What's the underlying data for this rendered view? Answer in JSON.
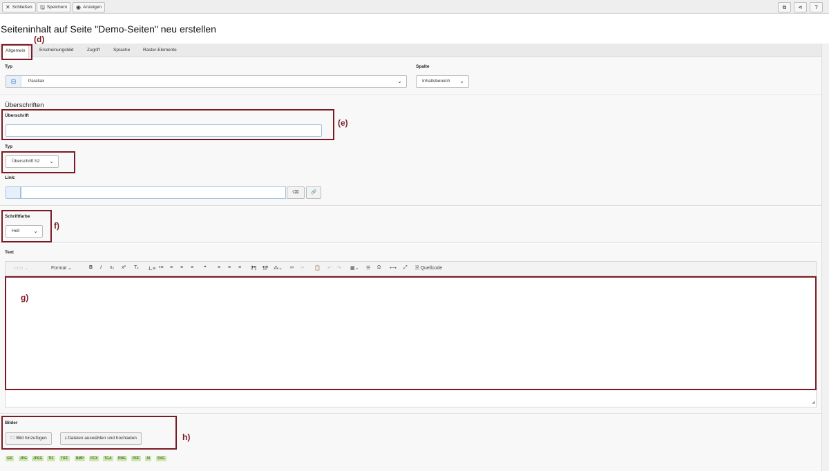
{
  "toolbar": {
    "close_label": "Schließen",
    "save_label": "Speichern",
    "view_label": "Anzeigen"
  },
  "page_title": "Seiteninhalt auf Seite \"Demo-Seiten\" neu erstellen",
  "tabs": [
    {
      "label": "Allgemein"
    },
    {
      "label": "Erscheinungsbild"
    },
    {
      "label": "Zugriff"
    },
    {
      "label": "Sprache"
    },
    {
      "label": "Raster-Elemente"
    }
  ],
  "general": {
    "type_label": "Typ",
    "type_value": "Parallax",
    "column_label": "Spalte",
    "column_value": "Inhaltsbereich"
  },
  "headings": {
    "section_title": "Überschriften",
    "heading_label": "Überschrift",
    "heading_value": "",
    "heading_type_label": "Typ",
    "heading_type_value": "Überschrift h2",
    "link_label": "Link:",
    "link_value": ""
  },
  "font": {
    "color_label": "Schriftfarbe",
    "color_value": "Hell"
  },
  "text": {
    "label": "Text",
    "format_label": "Format",
    "source_label": "Quellcode"
  },
  "images": {
    "label": "Bilder",
    "add_image_label": "Bild hinzufügen",
    "upload_label": "Dateien auswählen und hochladen",
    "allowed_types": [
      "GIF",
      "JPG",
      "JPEG",
      "TIF",
      "TIFF",
      "BMP",
      "PCX",
      "TGA",
      "PNG",
      "PDF",
      "AI",
      "SVG"
    ]
  },
  "annotations": {
    "d": "(d)",
    "e": "(e)",
    "f": "f)",
    "g": "g)",
    "h": "h)"
  },
  "colors": {
    "annotation": "#7a1a24",
    "chip_bg": "#cfe8b3",
    "input_border": "#9ec3e0"
  }
}
